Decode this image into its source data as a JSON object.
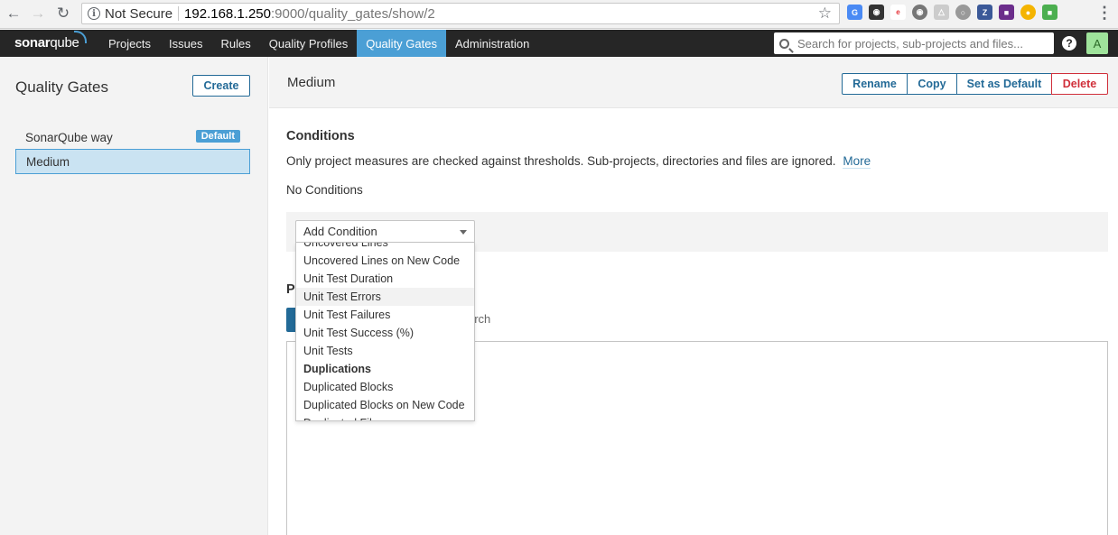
{
  "browser": {
    "security_label": "Not Secure",
    "url_host": "192.168.1.250",
    "url_path": ":9000/quality_gates/show/2"
  },
  "topnav": {
    "logo_bold": "sonar",
    "logo_rest": "qube",
    "items": [
      "Projects",
      "Issues",
      "Rules",
      "Quality Profiles",
      "Quality Gates",
      "Administration"
    ],
    "active_item": "Quality Gates",
    "search_placeholder": "Search for projects, sub-projects and files...",
    "help": "?",
    "avatar_letter": "A"
  },
  "sidebar": {
    "title": "Quality Gates",
    "create_label": "Create",
    "gates": [
      {
        "name": "SonarQube way",
        "badge": "Default"
      },
      {
        "name": "Medium",
        "badge": ""
      }
    ],
    "selected_gate": "Medium"
  },
  "main": {
    "gate_name": "Medium",
    "actions": [
      "Rename",
      "Copy",
      "Set as Default",
      "Delete"
    ],
    "conditions_title": "Conditions",
    "conditions_desc": "Only project measures are checked against thresholds. Sub-projects, directories and files are ignored.",
    "more_link": "More",
    "no_conditions": "No Conditions",
    "add_condition": {
      "value": "Add Condition",
      "options": [
        {
          "label": "Uncovered Lines",
          "type": "option",
          "partial": "top"
        },
        {
          "label": "Uncovered Lines on New Code",
          "type": "option"
        },
        {
          "label": "Unit Test Duration",
          "type": "option"
        },
        {
          "label": "Unit Test Errors",
          "type": "option",
          "highlighted": true
        },
        {
          "label": "Unit Test Failures",
          "type": "option"
        },
        {
          "label": "Unit Test Success (%)",
          "type": "option"
        },
        {
          "label": "Unit Tests",
          "type": "option"
        },
        {
          "label": "Duplications",
          "type": "group"
        },
        {
          "label": "Duplicated Blocks",
          "type": "option"
        },
        {
          "label": "Duplicated Blocks on New Code",
          "type": "option"
        },
        {
          "label": "Duplicated Files",
          "type": "option",
          "partial": "bottom"
        }
      ]
    },
    "projects_title_fragment": "P",
    "projects_search_fragment": "arch"
  },
  "colors": {
    "accent": "#4b9fd5",
    "link": "#236a97",
    "danger": "#d02f3a",
    "nav_bg": "#262626"
  }
}
